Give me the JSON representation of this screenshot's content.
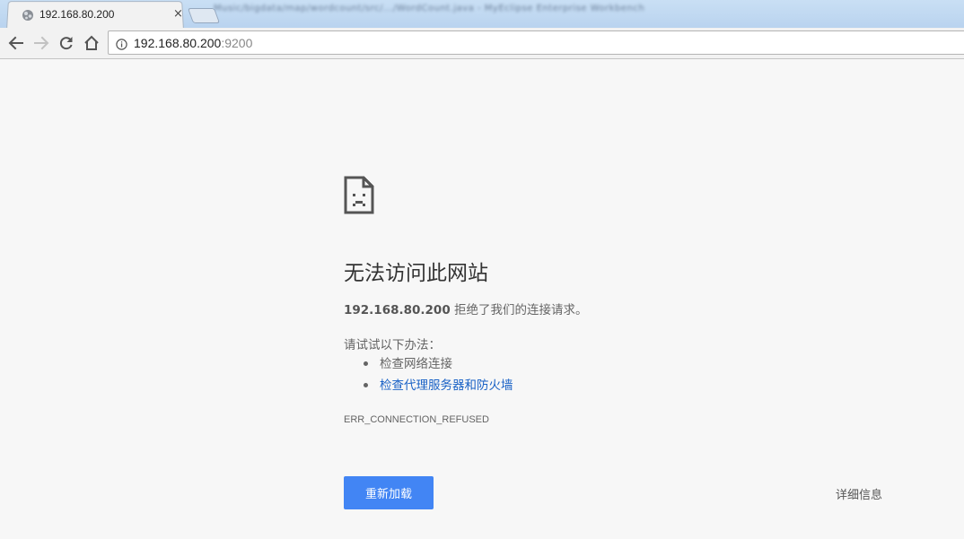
{
  "window": {
    "background_title": "Music/bigdata/map/wordcount/src/.../WordCount.java - MyEclipse Enterprise Workbench"
  },
  "tab": {
    "title": "192.168.80.200",
    "close_glyph": "×",
    "favicon": "globe-icon"
  },
  "toolbar": {
    "back_icon": "back-arrow-icon",
    "forward_icon": "forward-arrow-icon",
    "reload_icon": "reload-icon",
    "home_icon": "home-icon"
  },
  "omnibox": {
    "host": "192.168.80.200",
    "port": ":9200",
    "info_icon": "info-icon"
  },
  "error_page": {
    "icon": "sad-document-icon",
    "heading": "无法访问此网站",
    "summary_host": "192.168.80.200",
    "summary_text": " 拒绝了我们的连接请求。",
    "suggestions_title": "请试试以下办法：",
    "suggestions": [
      {
        "text": "检查网络连接",
        "is_link": false
      },
      {
        "text": "检查代理服务器和防火墙",
        "is_link": true
      }
    ],
    "error_code": "ERR_CONNECTION_REFUSED",
    "reload_label": "重新加载",
    "details_label": "详细信息"
  },
  "colors": {
    "page_background": "#f7f7f7",
    "primary_button": "#4285f4",
    "link": "#1a62c6",
    "text": "#646464",
    "heading": "#333333"
  }
}
